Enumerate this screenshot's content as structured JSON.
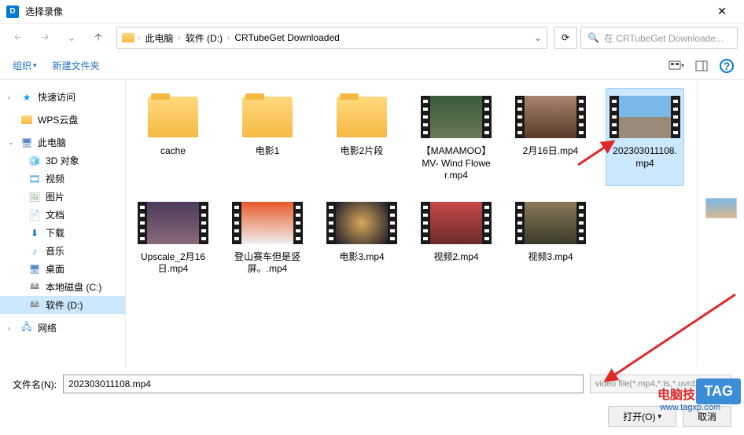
{
  "title": "选择录像",
  "breadcrumbs": [
    "此电脑",
    "软件 (D:)",
    "CRTubeGet Downloaded"
  ],
  "search_placeholder": "在 CRTubeGet Downloade...",
  "toolbar": {
    "organize": "组织",
    "new_folder": "新建文件夹"
  },
  "sidebar": {
    "quick": "快速访问",
    "wps": "WPS云盘",
    "pc": "此电脑",
    "obj3d": "3D 对象",
    "video": "视频",
    "pic": "图片",
    "doc": "文档",
    "download": "下载",
    "music": "音乐",
    "desktop": "桌面",
    "diskc": "本地磁盘 (C:)",
    "diskd": "软件 (D:)",
    "network": "网络"
  },
  "files": [
    {
      "name": "cache",
      "type": "folder"
    },
    {
      "name": "电影1",
      "type": "folder"
    },
    {
      "name": "电影2片段",
      "type": "folder"
    },
    {
      "name": "【MAMAMOO】MV- Wind Flower.mp4",
      "type": "video",
      "bg": "linear-gradient(#3a5a3a,#6a7a5a)"
    },
    {
      "name": "2月16日.mp4",
      "type": "video",
      "bg": "linear-gradient(#a8856a,#5a3a2a)"
    },
    {
      "name": "202303011108.mp4",
      "type": "video",
      "bg": "linear-gradient(#7ab8e8 50%,#9a8a7a 50%)",
      "selected": true
    },
    {
      "name": "Upscale_2月16日.mp4",
      "type": "video",
      "bg": "linear-gradient(#4a3a5a,#8a6a7a)"
    },
    {
      "name": "登山赛车但是竖屏。.mp4",
      "type": "video",
      "bg": "linear-gradient(#e85a2a,#f0f0f0)"
    },
    {
      "name": "电影3.mp4",
      "type": "video",
      "bg": "radial-gradient(circle,#d8a85a,#1a1a2a)"
    },
    {
      "name": "视频2.mp4",
      "type": "video",
      "bg": "linear-gradient(#c84a4a,#6a2a2a)"
    },
    {
      "name": "视频3.mp4",
      "type": "video",
      "bg": "linear-gradient(#8a7a5a,#3a3a2a)"
    }
  ],
  "footer": {
    "fn_label": "文件名(N):",
    "fn_value": "202303011108.mp4",
    "filter": "video file(*.mp4,*.ts,*.uvrd,*...",
    "open": "打开(O)",
    "cancel": "取消"
  },
  "watermark": {
    "title": "电脑技术网",
    "url": "www.tagxp.com",
    "tag": "TAG"
  }
}
